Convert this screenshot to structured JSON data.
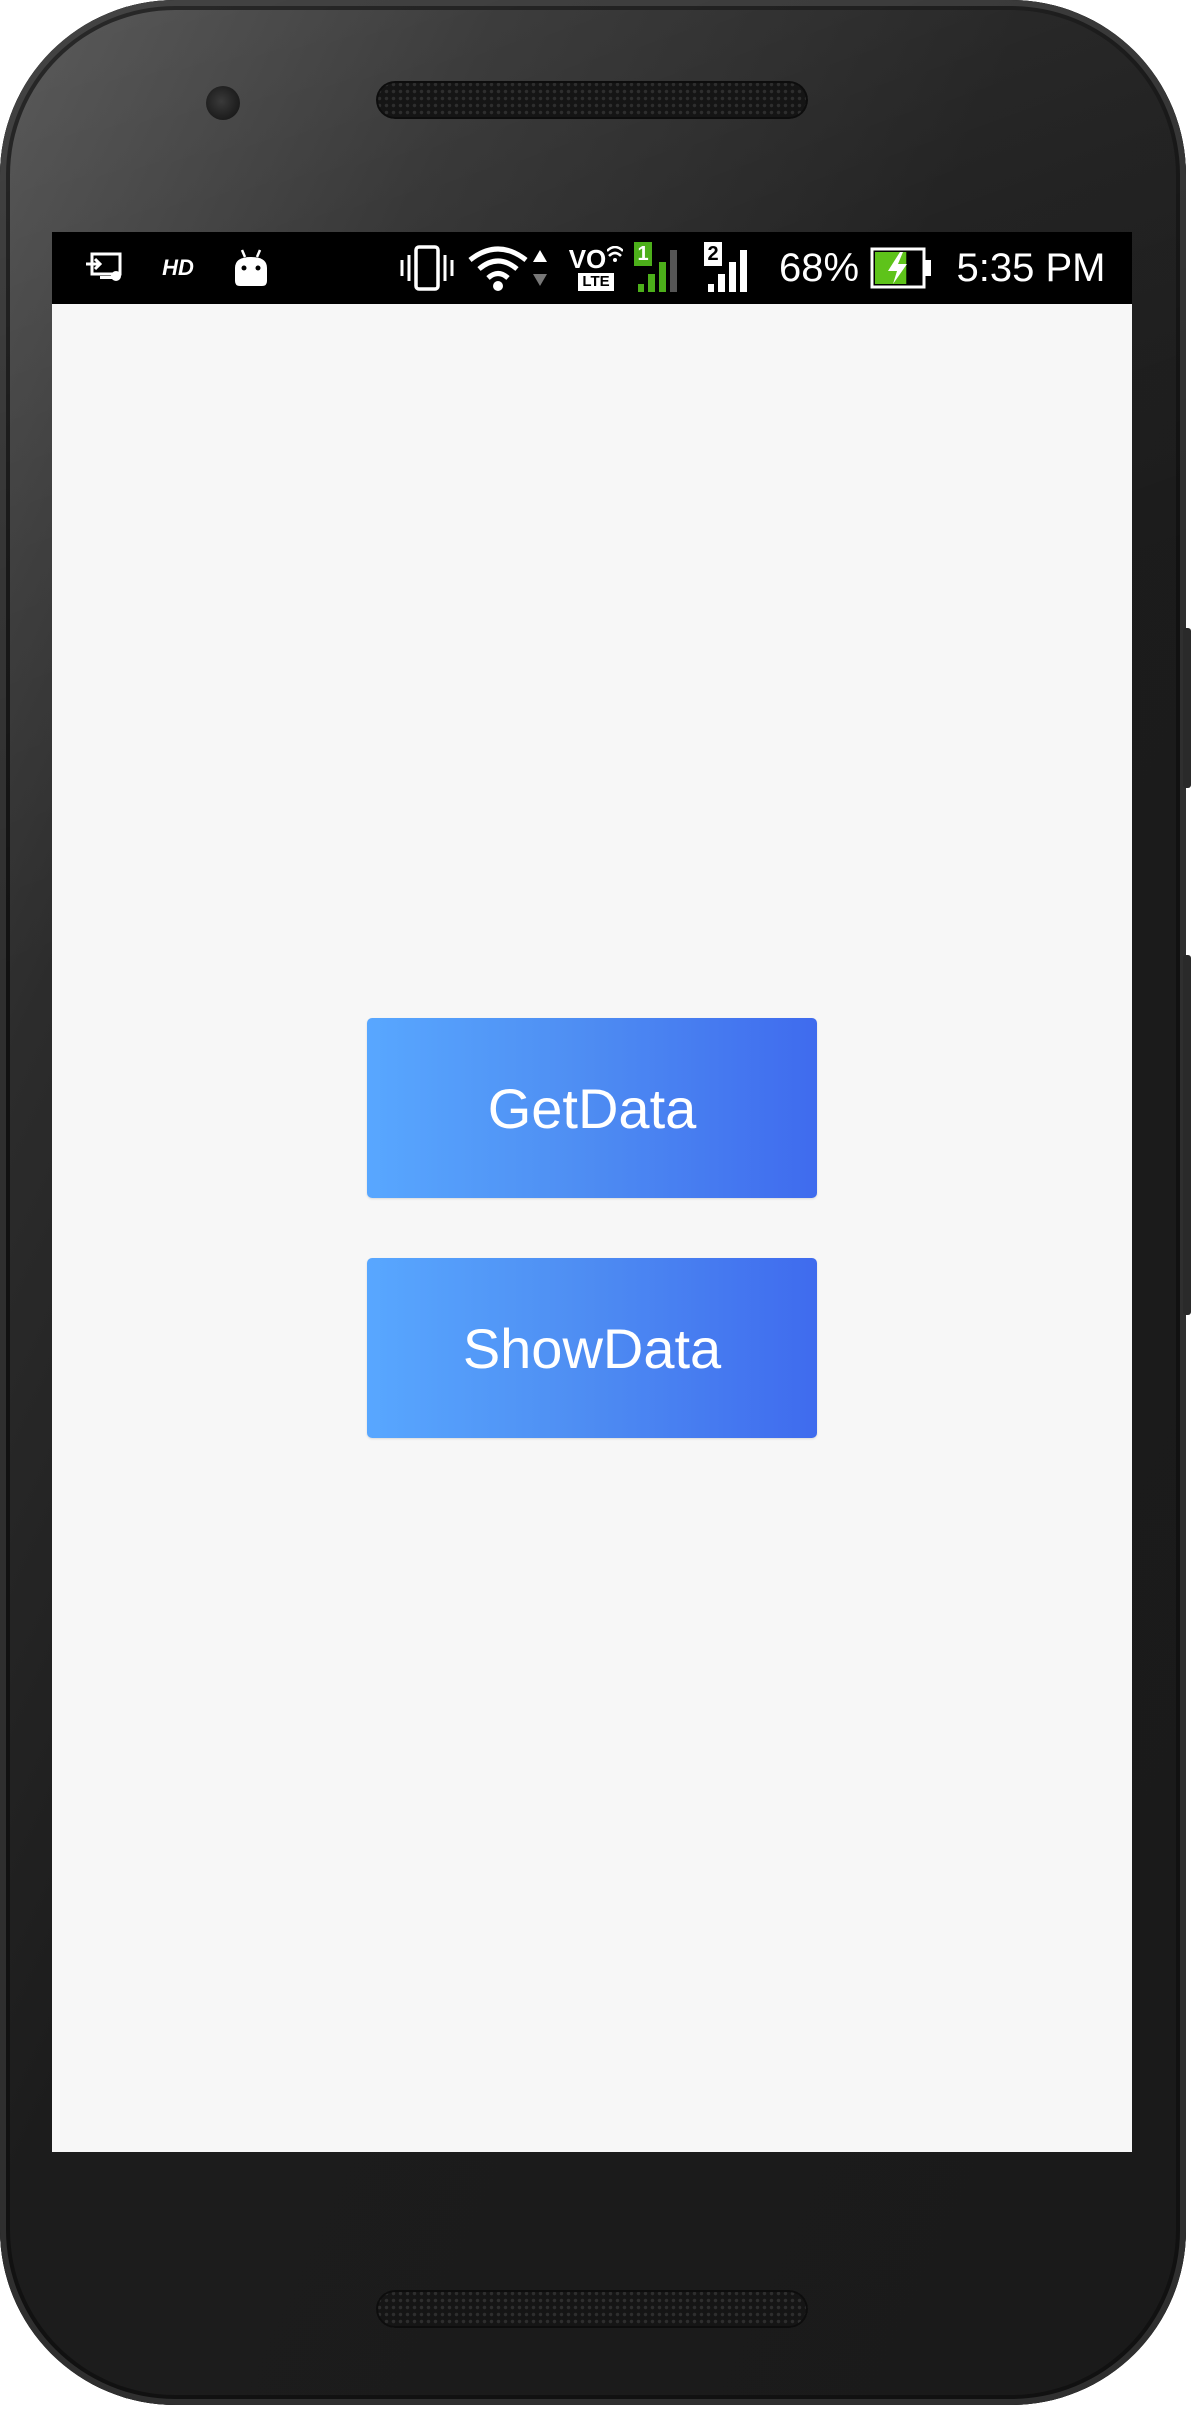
{
  "status_bar": {
    "hd_label": "HD",
    "volte_top": "VO",
    "volte_bottom": "LTE",
    "sim1_label": "1",
    "sim2_label": "2",
    "battery_percent": "68%",
    "battery_level": 0.68,
    "battery_charging": true,
    "time": "5:35 PM",
    "icons": [
      "cast-icon",
      "hd-icon",
      "android-icon",
      "vibrate-icon",
      "wifi-icon",
      "data-activity-icon",
      "volte-icon",
      "signal-sim1-icon",
      "signal-sim2-icon",
      "battery-charging-icon"
    ]
  },
  "main": {
    "buttons": [
      {
        "label": "GetData"
      },
      {
        "label": "ShowData"
      }
    ]
  },
  "colors": {
    "status_bar_bg": "#000000",
    "screen_bg": "#f7f7f7",
    "button_gradient_start": "#58a7ff",
    "button_gradient_end": "#3f6bee",
    "sim1_signal": "#4caf1a",
    "battery_fill": "#5ec31a"
  }
}
